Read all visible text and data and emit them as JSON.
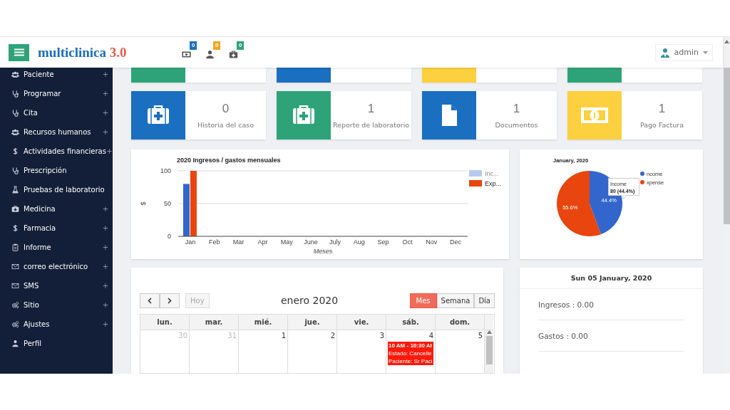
{
  "header": {
    "logo_name": "multiclinica",
    "logo_version": "3.0",
    "notifications": [
      {
        "badge": "0",
        "color": "#1a6fc0"
      },
      {
        "badge": "0",
        "color": "#f5a623"
      },
      {
        "badge": "0",
        "color": "#2ea37a"
      }
    ],
    "user": "admin"
  },
  "sidebar": {
    "items": [
      {
        "label": "Paciente",
        "toggle": "+"
      },
      {
        "label": "Programar",
        "toggle": "+"
      },
      {
        "label": "Cita",
        "toggle": "+"
      },
      {
        "label": "Recursos humanos",
        "toggle": "+"
      },
      {
        "label": "Actividades financieras",
        "toggle": "+"
      },
      {
        "label": "Prescripción"
      },
      {
        "label": "Pruebas de laboratorio"
      },
      {
        "label": "Medicina",
        "toggle": "+"
      },
      {
        "label": "Farmacia",
        "toggle": "+"
      },
      {
        "label": "Informe",
        "toggle": "+"
      },
      {
        "label": "correo electrónico",
        "toggle": "+"
      },
      {
        "label": "SMS",
        "toggle": "+"
      },
      {
        "label": "Sitio",
        "toggle": "+"
      },
      {
        "label": "Ajustes",
        "toggle": "+"
      },
      {
        "label": "Perfil"
      }
    ]
  },
  "top_cards": [
    {
      "color": "#2ea37a"
    },
    {
      "color": "#1a6fc0"
    },
    {
      "color": "#fcd03f"
    },
    {
      "color": "#2ea37a"
    }
  ],
  "stat_cards": [
    {
      "value": "0",
      "label": "Historia del caso",
      "color": "#1a6fc0"
    },
    {
      "value": "1",
      "label": "Reporte de laboratorio",
      "color": "#2ea37a"
    },
    {
      "value": "1",
      "label": "Documentos",
      "color": "#1a6fc0"
    },
    {
      "value": "1",
      "label": "Pago Factura",
      "color": "#fcd03f"
    }
  ],
  "bar_chart": {
    "chart_data": {
      "type": "bar",
      "title": "2020 Ingresos / gastos mensuales",
      "xlabel": "Meses",
      "ylabel": "$",
      "categories": [
        "Jan",
        "Feb",
        "Mar",
        "Apr",
        "May",
        "June",
        "July",
        "Aug",
        "Sep",
        "Oct",
        "Nov",
        "Dec"
      ],
      "series": [
        {
          "name": "Inc...",
          "color": "#3366cc",
          "values": [
            80,
            0,
            0,
            0,
            0,
            0,
            0,
            0,
            0,
            0,
            0,
            0
          ]
        },
        {
          "name": "Exp...",
          "color": "#e8450f",
          "values": [
            100,
            0,
            0,
            0,
            0,
            0,
            0,
            0,
            0,
            0,
            0,
            0
          ]
        }
      ],
      "ylim": [
        0,
        100
      ],
      "yticks": [
        0,
        50,
        100
      ],
      "legend": "right"
    },
    "legend_state": [
      {
        "faded": true
      },
      {
        "faded": false
      }
    ]
  },
  "pie_chart": {
    "chart_data": {
      "type": "pie",
      "title": "January, 2020",
      "categories": [
        "ncome",
        "xpense"
      ],
      "values": [
        44.4,
        55.6
      ],
      "colors": [
        "#3366cc",
        "#e8450f"
      ],
      "data_labels": true,
      "value_labels": [
        "44.4%",
        "55.6%"
      ],
      "legend": "right"
    },
    "tooltip": {
      "title": "Income",
      "value": "80 (44.4%)"
    }
  },
  "calendar": {
    "today": {
      "label": "Hoy",
      "disabled": true
    },
    "title": "enero 2020",
    "views": [
      {
        "label": "Mes",
        "selected": true
      },
      {
        "label": "Semana",
        "selected": false
      },
      {
        "label": "Día",
        "selected": false
      }
    ],
    "weekdays": [
      "lun.",
      "mar.",
      "mié.",
      "jue.",
      "vie.",
      "sáb.",
      "dom."
    ],
    "days": [
      {
        "number": "30",
        "other_month": true
      },
      {
        "number": "31",
        "other_month": true
      },
      {
        "number": "1",
        "other_month": false
      },
      {
        "number": "2",
        "other_month": false
      },
      {
        "number": "3",
        "other_month": false
      },
      {
        "number": "4",
        "other_month": false,
        "events": [
          {
            "time": "10 AM - 10:30 AI",
            "lines": [
              "Estado: Cancelle",
              "Paciente: Sr Paci"
            ]
          }
        ]
      },
      {
        "number": "5",
        "other_month": false
      }
    ]
  },
  "day_summary": {
    "title": "Sun 05 January, 2020",
    "rows": [
      "Ingresos : 0.00",
      "Gastos : 0.00"
    ]
  }
}
